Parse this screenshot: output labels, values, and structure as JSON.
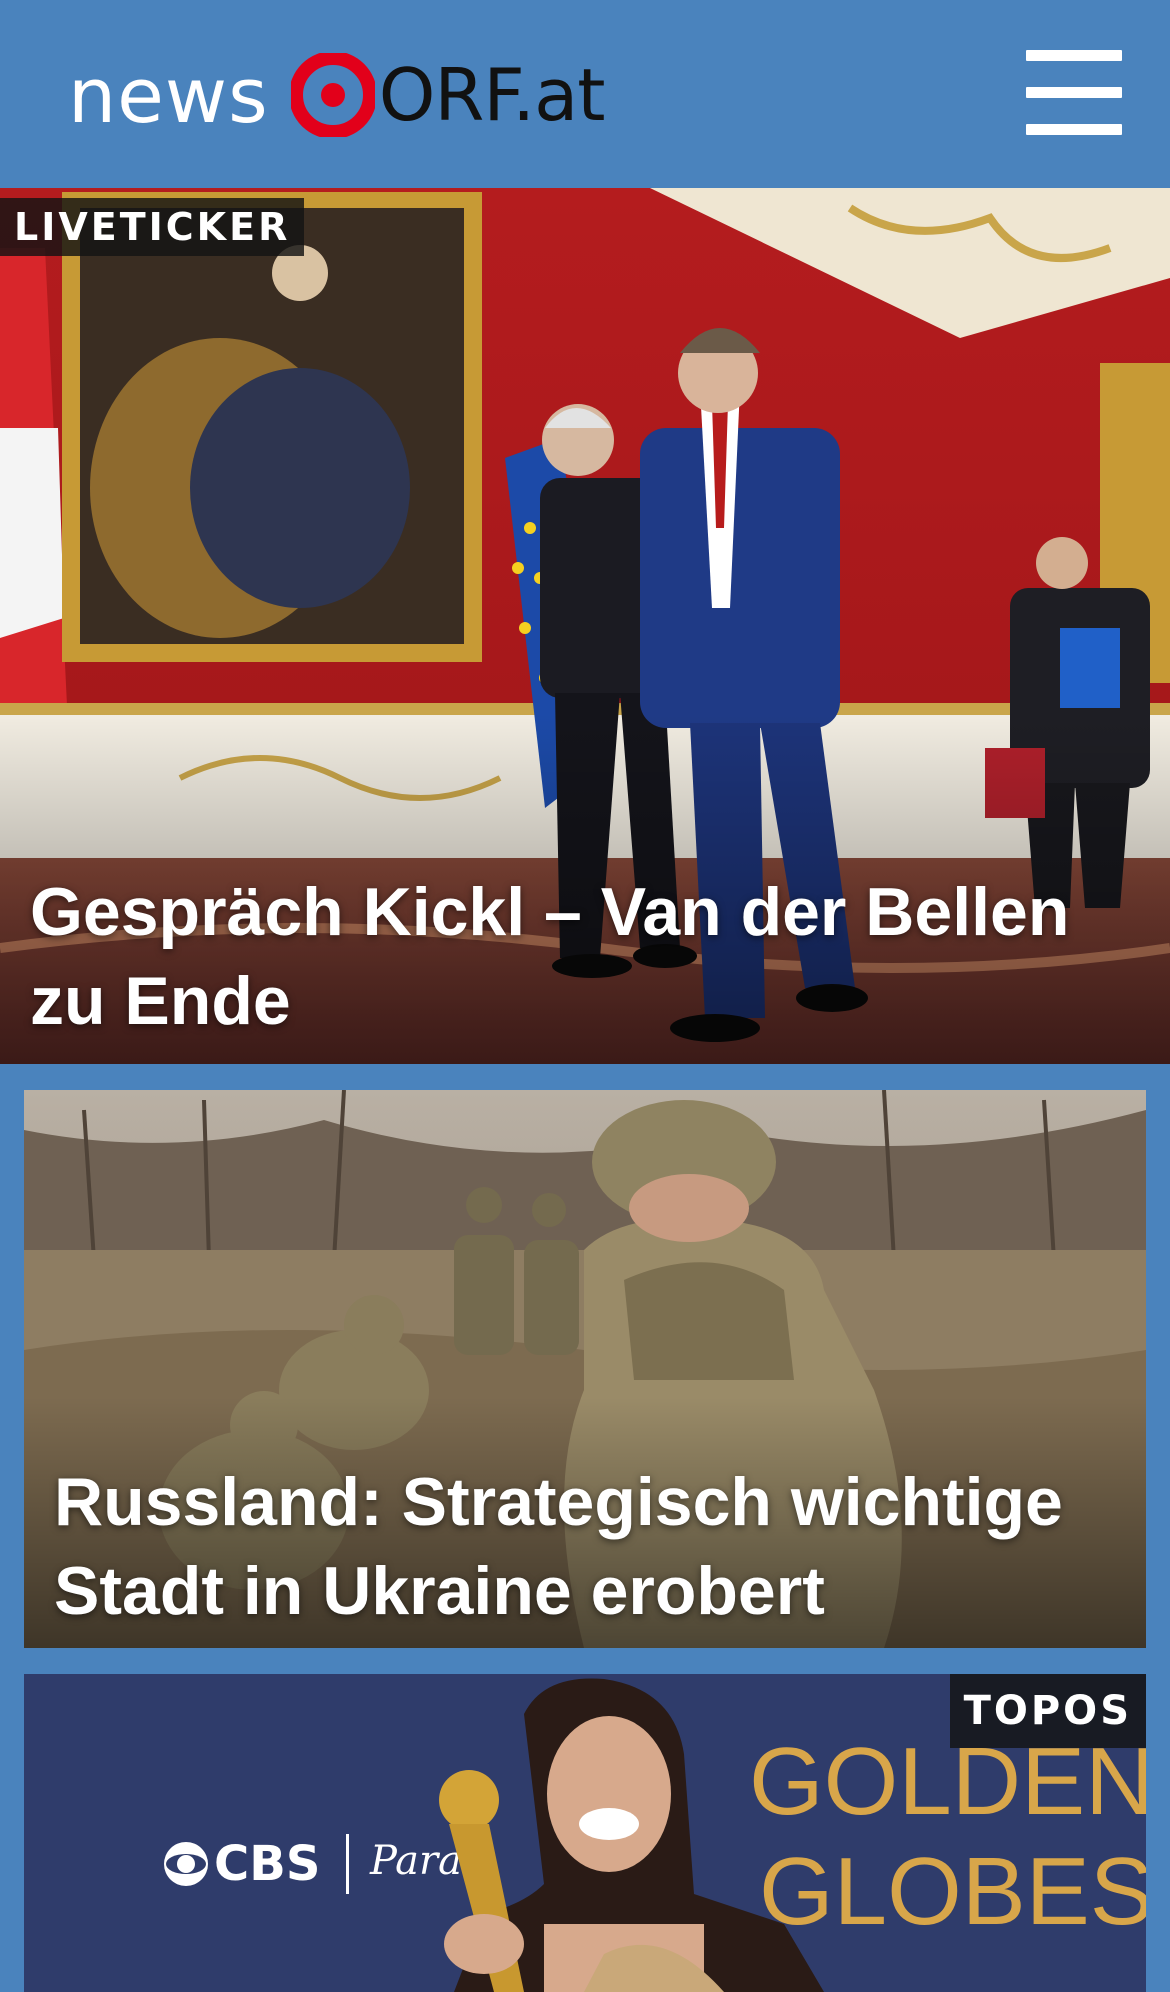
{
  "header": {
    "logo_left": "news",
    "logo_right": "ORF.at",
    "menu_icon": "hamburger-menu-icon"
  },
  "colors": {
    "header_bg": "#4a83bd",
    "logo_red": "#e2001a",
    "tag_bg": "#1a1a1a"
  },
  "stories": [
    {
      "tag": "LIVETICKER",
      "headline": "Gespräch Kickl – Van der Bellen zu Ende"
    },
    {
      "tag": "",
      "headline": "Russland: Strategisch wichtige Stadt in Ukraine erobert"
    },
    {
      "tag": "TOPOS",
      "headline": "",
      "image_text": [
        "CBS",
        "GOLDEN",
        "GLOBES"
      ]
    }
  ]
}
